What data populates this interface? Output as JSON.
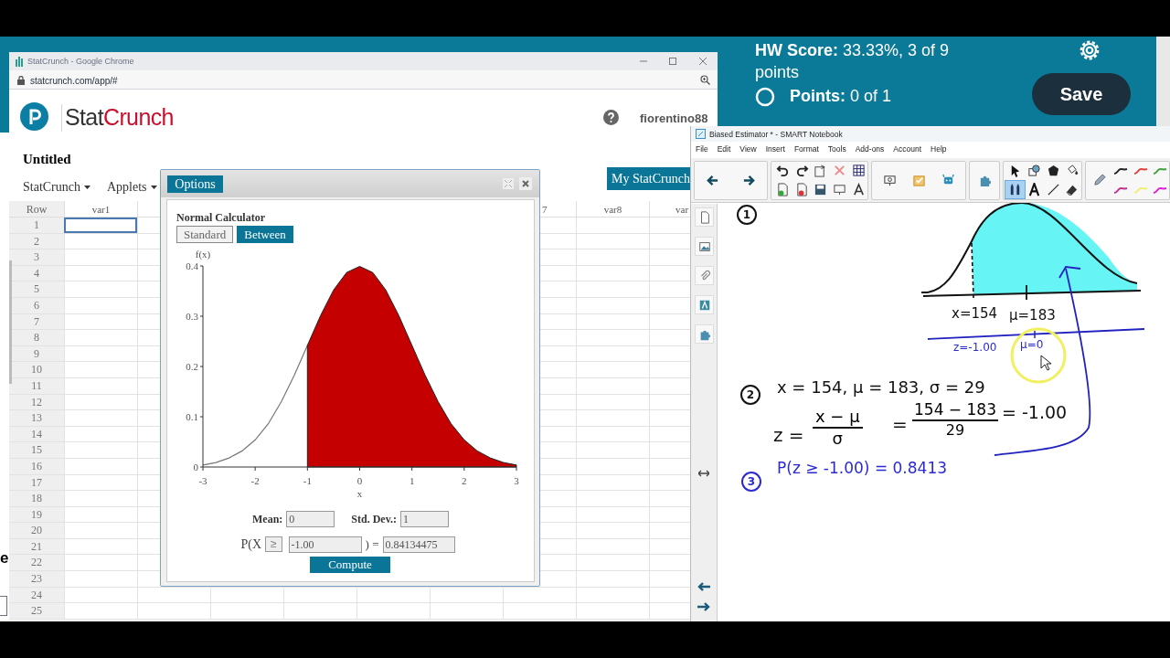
{
  "background_page": {
    "edge_text": "e"
  },
  "browser": {
    "title": "StatCrunch - Google Chrome",
    "url": "statcrunch.com/app/#"
  },
  "statcrunch": {
    "brand_first": "Stat",
    "brand_second": "Crunch",
    "user": "fiorentino88",
    "document_title": "Untitled",
    "menus": [
      "StatCrunch",
      "Applets"
    ],
    "my_button": "My StatCrunch"
  },
  "grid": {
    "row_header": "Row",
    "column_headers": [
      "var1",
      "7",
      "var8",
      "var"
    ],
    "rows": [
      {
        "number": "1",
        "selected": true
      },
      {
        "number": "2",
        "selected": false
      },
      {
        "number": "3",
        "selected": false
      },
      {
        "number": "4",
        "selected": false
      },
      {
        "number": "5",
        "selected": false
      },
      {
        "number": "6",
        "selected": false
      },
      {
        "number": "7",
        "selected": false
      },
      {
        "number": "8",
        "selected": false
      },
      {
        "number": "9",
        "selected": false
      },
      {
        "number": "10",
        "selected": false
      },
      {
        "number": "11",
        "selected": false
      },
      {
        "number": "12",
        "selected": false
      },
      {
        "number": "13",
        "selected": false
      },
      {
        "number": "14",
        "selected": false
      },
      {
        "number": "15",
        "selected": false
      },
      {
        "number": "16",
        "selected": false
      },
      {
        "number": "17",
        "selected": false
      },
      {
        "number": "18",
        "selected": false
      },
      {
        "number": "19",
        "selected": false
      },
      {
        "number": "20",
        "selected": false
      },
      {
        "number": "21",
        "selected": false
      },
      {
        "number": "22",
        "selected": false
      },
      {
        "number": "23",
        "selected": false
      },
      {
        "number": "24",
        "selected": false
      },
      {
        "number": "25",
        "selected": false
      }
    ]
  },
  "dialog": {
    "options_button": "Options",
    "heading": "Normal Calculator",
    "tabs": [
      {
        "label": "Standard",
        "selected": false
      },
      {
        "label": "Between",
        "selected": true
      }
    ],
    "chart_data": {
      "type": "area",
      "xlabel": "x",
      "ylabel": "f(x)",
      "xlim": [
        -3,
        3
      ],
      "ylim": [
        0,
        0.4
      ],
      "xticks": [
        -3,
        -2,
        -1,
        0,
        1,
        2,
        3
      ],
      "yticks": [
        0,
        0.1,
        0.2,
        0.3,
        0.4
      ],
      "x": [
        -3,
        -2.75,
        -2.5,
        -2.25,
        -2,
        -1.75,
        -1.5,
        -1.25,
        -1,
        -0.75,
        -0.5,
        -0.25,
        0,
        0.25,
        0.5,
        0.75,
        1,
        1.25,
        1.5,
        1.75,
        2,
        2.25,
        2.5,
        2.75,
        3
      ],
      "series": [
        {
          "type": "line",
          "color": "#777777",
          "values": [
            0.004,
            0.009,
            0.018,
            0.032,
            0.054,
            0.086,
            0.13,
            0.183,
            0.242,
            null,
            null,
            null,
            null,
            null,
            null,
            null,
            null,
            null,
            null,
            null,
            null,
            null,
            null,
            null,
            null
          ]
        },
        {
          "color": "#c40000",
          "values": [
            null,
            null,
            null,
            null,
            null,
            null,
            null,
            null,
            0.242,
            0.301,
            0.352,
            0.387,
            0.399,
            0.387,
            0.352,
            0.301,
            0.242,
            0.183,
            0.13,
            0.086,
            0.054,
            0.032,
            0.018,
            0.009,
            0.004
          ]
        }
      ]
    },
    "mean_label": "Mean:",
    "mean": "0",
    "sd_label": "Std. Dev.:",
    "sd": "1",
    "prob_open": "P(X",
    "operator": "≥",
    "x_value": "-1.00",
    "prob_close": ") =",
    "result": "0.84134475",
    "compute_button": "Compute"
  },
  "score": {
    "hw_score": "**HW Score:** 33.33%, 3 of 9 points",
    "points": "**Points:** 0 of 1",
    "save_button": "Save"
  },
  "notebook": {
    "title": "Biased Estimator * - SMART Notebook",
    "menus": [
      "File",
      "Edit",
      "View",
      "Insert",
      "Format",
      "Tools",
      "Add-ons",
      "Account",
      "Help"
    ],
    "tools": [
      {
        "kind": "pointer",
        "selected": false
      },
      {
        "kind": "shapes",
        "selected": false
      },
      {
        "kind": "polygon",
        "selected": false
      },
      {
        "kind": "fill",
        "selected": false
      },
      {
        "kind": "marker",
        "selected": true
      },
      {
        "kind": "text",
        "selected": false
      },
      {
        "kind": "line",
        "selected": false
      },
      {
        "kind": "eraser",
        "selected": false
      }
    ],
    "pens": [
      {
        "color": "#222222"
      },
      {
        "color": "#e04040"
      },
      {
        "color": "#40a040"
      },
      {
        "color": "#c03090"
      },
      {
        "color": "#f0f070"
      },
      {
        "color": "#e020d0"
      }
    ],
    "page": {
      "step1": "1",
      "x_label": "x=154",
      "mu_label": "μ=183",
      "z_label": "z=-1.00",
      "mu_z_label": "μ=0",
      "step2": "2",
      "givens": "x = 154,  μ = 183,  σ = 29",
      "z_eq": "z =",
      "num1": "x − μ",
      "den1": "σ",
      "eq": "=",
      "num2": "154 − 183",
      "den2": "29",
      "z_result": "= -1.00",
      "step3": "3",
      "probability": "P(z ≥ -1.00) =  0.8413"
    }
  }
}
